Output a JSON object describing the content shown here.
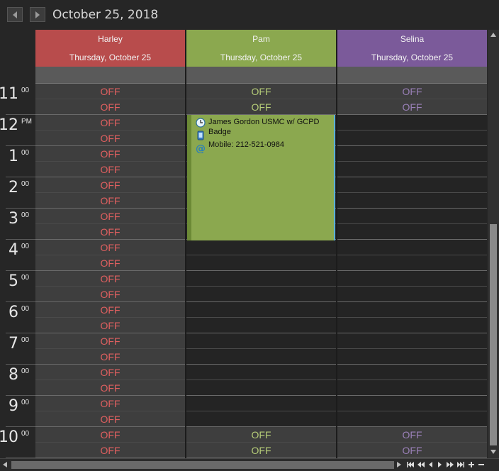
{
  "header": {
    "date_title": "October 25, 2018"
  },
  "colors": {
    "harley": "#b84c4c",
    "pam": "#8ba84f",
    "selina": "#7b5a9a",
    "harley_off": "#e06060",
    "pam_off": "#b5cc78",
    "selina_off": "#9a80b8"
  },
  "resources": [
    {
      "name": "Harley",
      "date": "Thursday, October 25"
    },
    {
      "name": "Pam",
      "date": "Thursday, October 25"
    },
    {
      "name": "Selina",
      "date": "Thursday, October 25"
    }
  ],
  "hours": [
    {
      "h": "11",
      "m": "00"
    },
    {
      "h": "12",
      "m": "PM"
    },
    {
      "h": "1",
      "m": "00"
    },
    {
      "h": "2",
      "m": "00"
    },
    {
      "h": "3",
      "m": "00"
    },
    {
      "h": "4",
      "m": "00"
    },
    {
      "h": "5",
      "m": "00"
    },
    {
      "h": "6",
      "m": "00"
    },
    {
      "h": "7",
      "m": "00"
    },
    {
      "h": "8",
      "m": "00"
    },
    {
      "h": "9",
      "m": "00"
    },
    {
      "h": "10",
      "m": "00"
    }
  ],
  "off_label": "OFF",
  "appointment": {
    "title_line1": "James Gordon USMC w/ GCPD",
    "title_line2": "Badge",
    "mobile": "Mobile: 212-521-0984",
    "icons": [
      "recurrence-clock-icon",
      "phone-icon",
      "email-at-icon"
    ]
  },
  "scrollbar_nav": [
    "first-icon",
    "prev-page-icon",
    "prev-icon",
    "next-icon",
    "next-page-icon",
    "last-icon",
    "zoom-in-icon",
    "zoom-out-icon"
  ]
}
